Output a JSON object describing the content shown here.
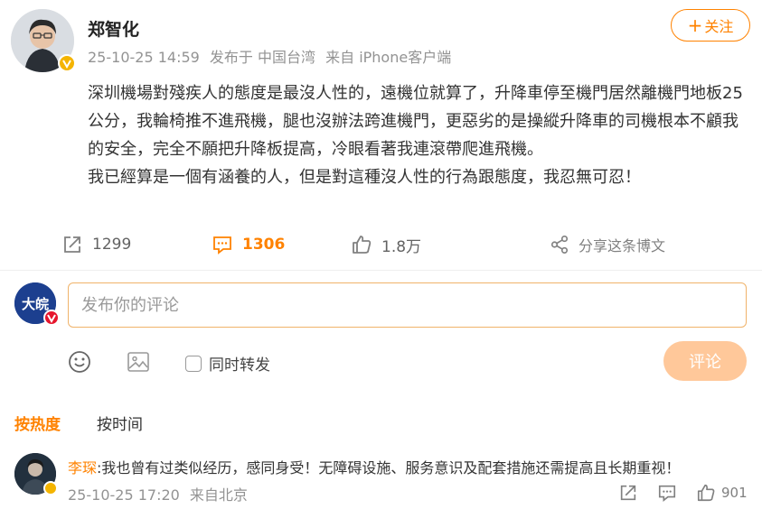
{
  "post": {
    "author": "郑智化",
    "date": "25-10-25 14:59",
    "location": "发布于 中国台湾",
    "source": "来自 iPhone客户端",
    "follow_label": "关注",
    "follow_plus": "+",
    "paragraphs": [
      "深圳機場對殘疾人的態度是最沒人性的，遠機位就算了，升降車停至機門居然離機門地板25公分，我輪椅推不進飛機，腿也沒辦法跨進機門，更惡劣的是操縱升降車的司機根本不顧我的安全，完全不願把升降板提高，冷眼看著我連滾帶爬進飛機。",
      "我已經算是一個有涵養的人，但是對這種沒人性的行為跟態度，我忍無可忍！"
    ],
    "reposts": "1299",
    "comments": "1306",
    "likes": "1.8万",
    "share_label": "分享这条博文",
    "icons": [
      "avatar",
      "verified-badge-icon",
      "repost-icon",
      "comment-icon",
      "like-icon",
      "share-icon"
    ]
  },
  "composer": {
    "placeholder": "发布你的评论",
    "repost_label": "同时转发",
    "submit_label": "评论",
    "avatar_text": "大皖",
    "icons": [
      "emoji-icon",
      "image-icon"
    ]
  },
  "sort": {
    "hot": "按热度",
    "time": "按时间"
  },
  "comment": {
    "author": "李琛",
    "text": ":我也曾有过类似经历，感同身受！无障碍设施、服务意识及配套措施还需提高且长期重视！",
    "date": "25-10-25 17:20",
    "source": "来自北京",
    "likes": "901",
    "icons": [
      "repost-icon",
      "comment-icon",
      "like-icon"
    ]
  },
  "colors": {
    "accent": "#ff8200",
    "muted": "#939393",
    "submit_disabled": "#ffc89a",
    "verified_gold": "#f4b400",
    "verified_red": "#e6162d"
  }
}
